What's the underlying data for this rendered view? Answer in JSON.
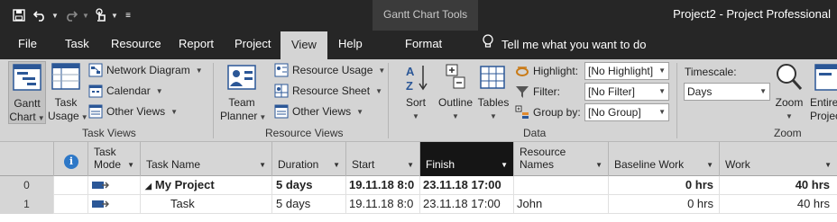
{
  "app": {
    "window_title": "Project2  -  Project Professional",
    "contextual_tab_group": "Gantt Chart Tools"
  },
  "tabs": [
    {
      "label": "File"
    },
    {
      "label": "Task"
    },
    {
      "label": "Resource"
    },
    {
      "label": "Report"
    },
    {
      "label": "Project"
    },
    {
      "label": "View",
      "active": true
    },
    {
      "label": "Help"
    },
    {
      "label": "Format"
    }
  ],
  "tell_me": "Tell me what you want to do",
  "ribbon": {
    "task_views": {
      "label": "Task Views",
      "gantt_line1": "Gantt",
      "gantt_line2": "Chart",
      "task_usage_line1": "Task",
      "task_usage_line2": "Usage",
      "network_diagram": "Network Diagram",
      "calendar": "Calendar",
      "other_views": "Other Views"
    },
    "resource_views": {
      "label": "Resource Views",
      "team_planner_line1": "Team",
      "team_planner_line2": "Planner",
      "resource_usage": "Resource Usage",
      "resource_sheet": "Resource Sheet",
      "other_views": "Other Views"
    },
    "data": {
      "label": "Data",
      "sort": "Sort",
      "outline": "Outline",
      "tables": "Tables",
      "highlight_label": "Highlight:",
      "highlight_value": "[No Highlight]",
      "filter_label": "Filter:",
      "filter_value": "[No Filter]",
      "groupby_label": "Group by:",
      "groupby_value": "[No Group]"
    },
    "zoom": {
      "label": "Zoom",
      "timescale_label": "Timescale:",
      "timescale_value": "Days",
      "zoom_button": "Zoom",
      "entire_line1": "Entire",
      "entire_line2": "Project"
    }
  },
  "grid": {
    "columns": {
      "task_mode_line1": "Task",
      "task_mode_line2": "Mode",
      "task_name": "Task Name",
      "duration": "Duration",
      "start": "Start",
      "finish": "Finish",
      "resource_line1": "Resource",
      "resource_line2": "Names",
      "baseline_work": "Baseline Work",
      "work": "Work"
    },
    "rows": [
      {
        "num": "0",
        "expander": "◢",
        "name": "My Project",
        "duration": "5 days",
        "start": "19.11.18 8:0",
        "finish": "23.11.18 17:00",
        "resource": "",
        "baseline_work": "0 hrs",
        "work": "40 hrs"
      },
      {
        "num": "1",
        "expander": "",
        "name": "Task",
        "duration": "5 days",
        "start": "19.11.18 8:0",
        "finish": "23.11.18 17:00",
        "resource": "John",
        "baseline_work": "0 hrs",
        "work": "40 hrs"
      }
    ]
  }
}
